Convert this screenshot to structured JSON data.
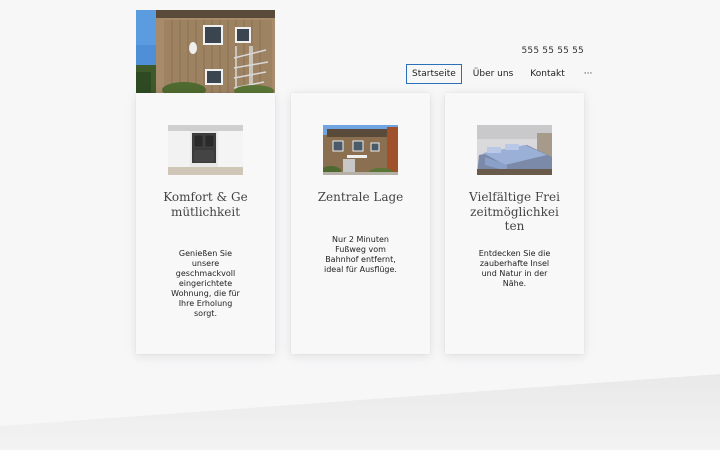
{
  "header": {
    "phone": "555 55 55 55"
  },
  "nav": {
    "items": [
      {
        "label": "Startseite",
        "active": true
      },
      {
        "label": "Über uns",
        "active": false
      },
      {
        "label": "Kontakt",
        "active": false
      },
      {
        "label": "···",
        "active": false
      }
    ]
  },
  "features": [
    {
      "title": "Komfort & Gemütlichkeit",
      "text": "Genießen Sie unsere geschmackvoll eingerichtete Wohnung, die für Ihre Erholung sorgt."
    },
    {
      "title": "Zentrale Lage",
      "text": "Nur 2 Minuten Fußweg vom Bahnhof entfernt, ideal für Ausflüge."
    },
    {
      "title": "Vielfältige Freizeitmöglichkeiten",
      "text": "Entdecken Sie die zauberhafte Insel und Natur in der Nähe."
    }
  ],
  "colors": {
    "background": "#f7f7f8",
    "accent": "#2d6fb8",
    "card": "#f8f8f8"
  }
}
